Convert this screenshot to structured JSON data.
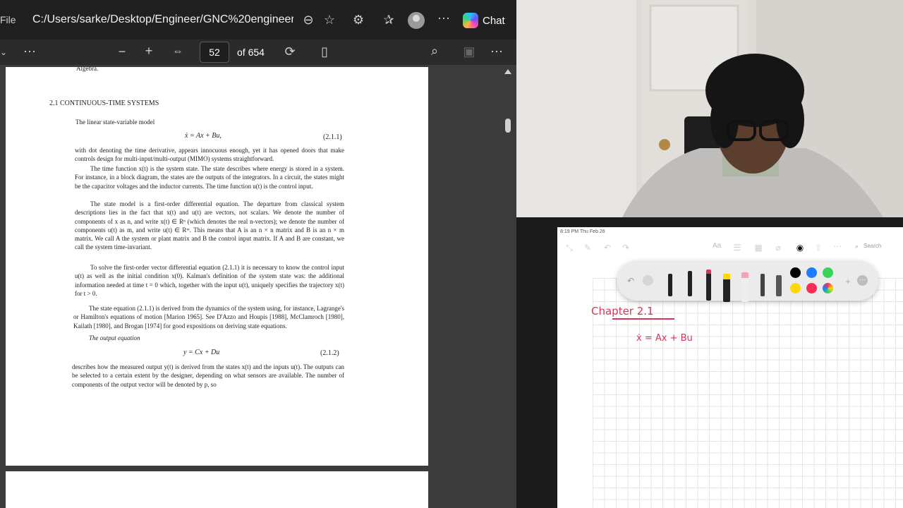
{
  "browser": {
    "file_label": "File",
    "url": "C:/Users/sarke/Desktop/Engineer/GNC%20engineeri...",
    "chat_label": "Chat",
    "colors": {
      "toolbar": "#202020",
      "chat_accent": "#6f4dff"
    }
  },
  "pdf_toolbar": {
    "page_number": "52",
    "page_count": "of 654"
  },
  "pdf_page": {
    "top_fragment": "Algebra.",
    "section_heading": "2.1  CONTINUOUS-TIME SYSTEMS",
    "intro": "The linear state-variable model",
    "eq1": "ẋ = Ax + Bu,",
    "eq1_no": "(2.1.1)",
    "p1": "with dot denoting the time derivative, appears innocuous enough, yet it has opened doors that make controls design for multi-input/multi-output (MIMO) systems straightforward.",
    "p2": "The time function x(t) is the system state. The state describes where energy is stored in a system. For instance, in a block diagram, the states are the outputs of the integrators. In a circuit, the states might be the capacitor voltages and the inductor currents. The time function u(t) is the control input.",
    "p3": "The state model is a first-order differential equation. The departure from classical system descriptions lies in the fact that x(t) and u(t) are vectors, not scalars. We denote the number of components of x as n, and write x(t) ∈ Rⁿ (which denotes the real n-vectors); we denote the number of components u(t) as m, and write u(t) ∈ Rᵐ. This means that A is an n × n matrix and B is an n × m matrix. We call A the system or plant matrix and B the control input matrix. If A and B are constant, we call the system time-invariant.",
    "p4": "To solve the first-order vector differential equation (2.1.1) it is necessary to know the control input u(t) as well as the initial condition x(0). Kalman's definition of the system state was: the additional information needed at time t = 0 which, together with the input u(t), uniquely specifies the trajectory x(t) for t > 0.",
    "p5": "The state equation (2.1.1) is derived from the dynamics of the system using, for instance, Lagrange's or Hamilton's equations of motion [Marion 1965]. See D'Azzo and Houpis [1988], McClamroch [1980], Kailath [1980], and Brogan [1974] for good expositions on deriving state equations.",
    "p6": "The output equation",
    "eq2": "y = Cx + Du",
    "eq2_no": "(2.1.2)",
    "p7": "describes how the measured output y(t) is derived from the states x(t) and the inputs u(t). The outputs can be selected to a certain extent by the designer, depending on what sensors are available. The number of components of the output vector will be denoted by p, so"
  },
  "notes": {
    "status": "8:19 PM  Thu Feb 26",
    "search_label": "Search",
    "font_label": "Aa",
    "handwriting": {
      "title": "Chapter  2.1",
      "equation": "ẋ =  Ax + Bu"
    },
    "palette": [
      "#000000",
      "#1e7cff",
      "#3ad35a",
      "#ffd60a",
      "#ff2d55"
    ],
    "ink_color": "#d3385a"
  }
}
